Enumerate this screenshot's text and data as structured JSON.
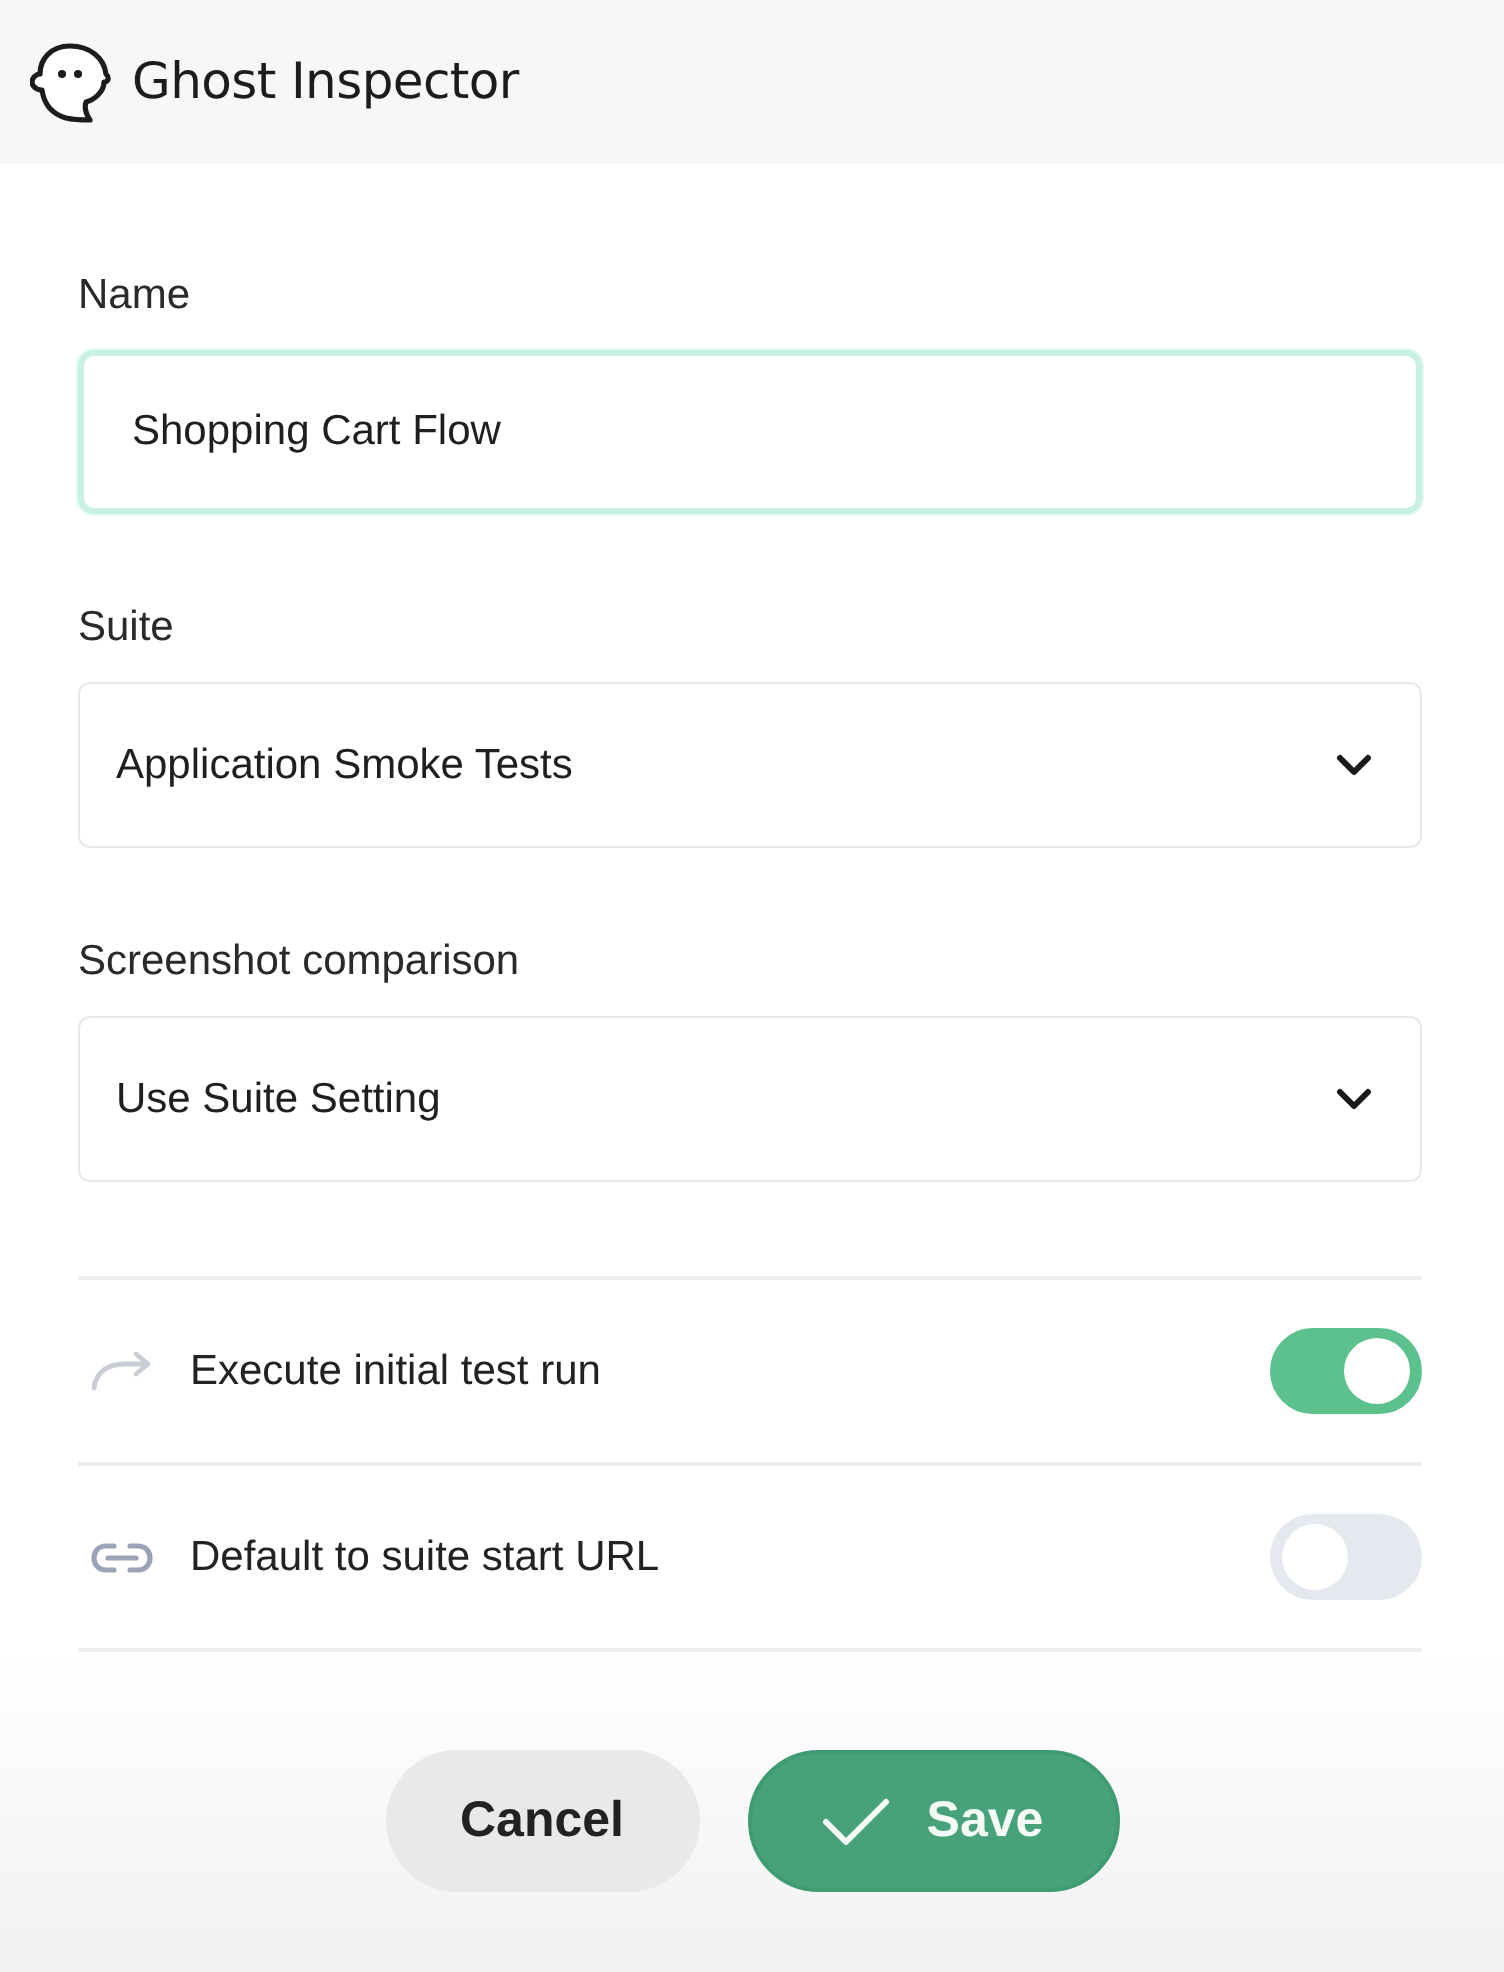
{
  "header": {
    "title": "Ghost Inspector"
  },
  "fields": [
    {
      "kind": "text",
      "label": "Name",
      "value": "Shopping Cart Flow",
      "focused": true
    },
    {
      "kind": "select",
      "label": "Suite",
      "value": "Application Smoke Tests",
      "focused": false
    },
    {
      "kind": "select",
      "label": "Screenshot comparison",
      "value": "Use Suite Setting",
      "focused": false
    }
  ],
  "options": [
    {
      "label": "Execute initial test run",
      "on": true
    },
    {
      "label": "Default to suite start URL",
      "on": false
    }
  ],
  "buttons": [
    {
      "label": "Cancel",
      "kind": "secondary"
    },
    {
      "label": "Save",
      "kind": "primary"
    }
  ]
}
